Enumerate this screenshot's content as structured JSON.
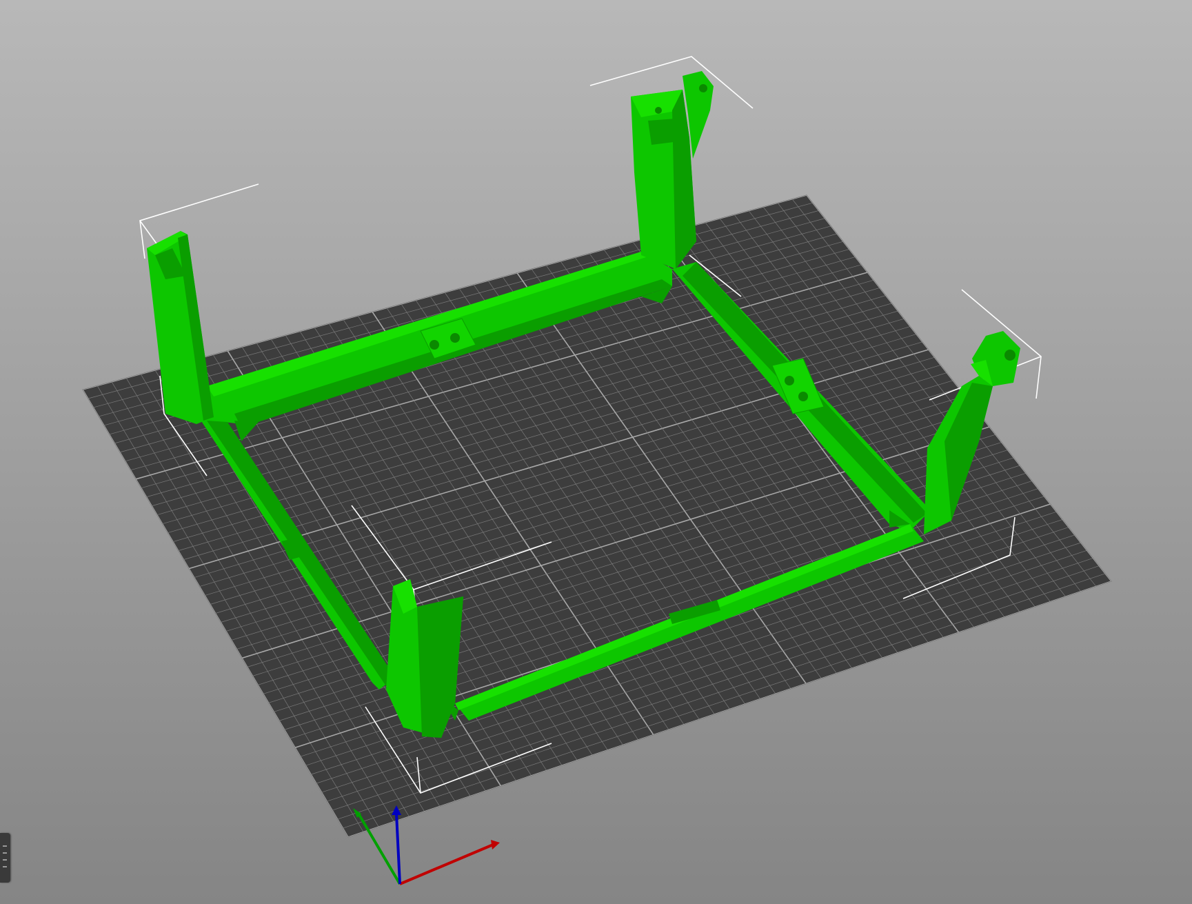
{
  "app": {
    "view": "3D Editor view",
    "bed": {
      "grid_color": "#3d3d3d",
      "grid_line_color": "#7a7a7a",
      "grid_major_line_color": "#a8a8a8"
    },
    "model": {
      "color": "#0fd100",
      "shade_color": "#0a9e00",
      "selected_instances": 4
    },
    "axes": {
      "x_color": "#c00000",
      "y_color": "#00a000",
      "z_color": "#0000c0"
    },
    "background": {
      "top": "#b8b8b8",
      "bottom": "#858585"
    }
  },
  "sidebar": {
    "collapse_handle_icon": "grip-icon"
  }
}
